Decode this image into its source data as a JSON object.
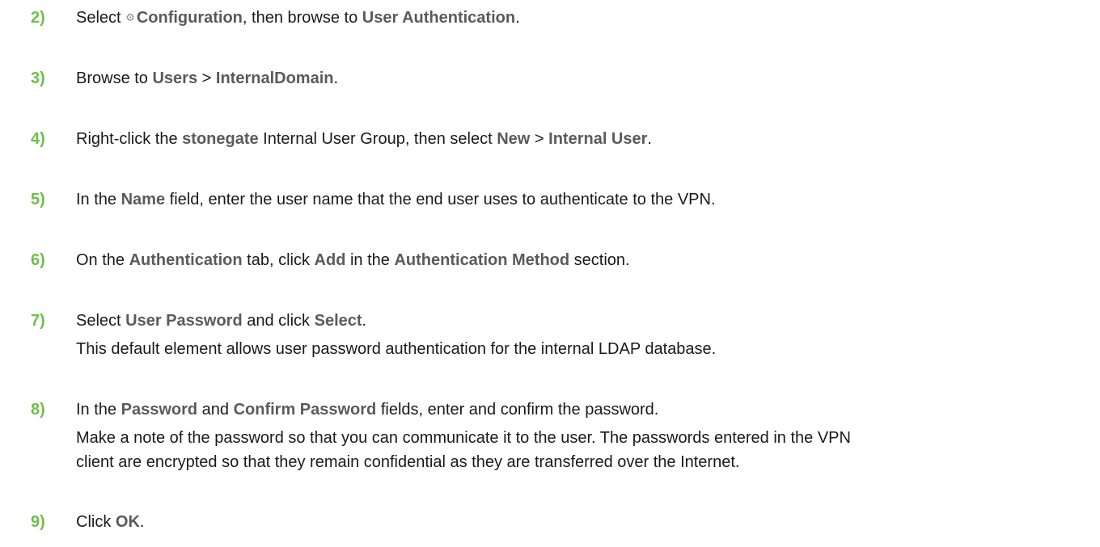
{
  "colors": {
    "step_number": "#6cc04a",
    "ui_term": "#5a5a5a",
    "body_text": "#1a1a1a"
  },
  "icons": {
    "configuration": "gear-icon"
  },
  "steps": [
    {
      "number": "2)",
      "t0": "Select ",
      "configuration_icon_glyph": "⚙",
      "t1": "Configuration",
      "t2": ", then browse to ",
      "t3": "User Authentication",
      "t4": "."
    },
    {
      "number": "3)",
      "t0": "Browse to ",
      "t1": "Users",
      "t2": " > ",
      "t3": "InternalDomain",
      "t4": "."
    },
    {
      "number": "4)",
      "t0": "Right-click the ",
      "t1": "stonegate",
      "t2": " Internal User Group, then select ",
      "t3": "New",
      "t4": " > ",
      "t5": "Internal User",
      "t6": "."
    },
    {
      "number": "5)",
      "t0": "In the ",
      "t1": "Name",
      "t2": " field, enter the user name that the end user uses to authenticate to the VPN."
    },
    {
      "number": "6)",
      "t0": "On the ",
      "t1": "Authentication",
      "t2": " tab, click ",
      "t3": "Add",
      "t4": " in the ",
      "t5": "Authentication Method",
      "t6": " section."
    },
    {
      "number": "7)",
      "t0": "Select ",
      "t1": "User Password",
      "t2": " and click ",
      "t3": "Select",
      "t4": ".",
      "note": "This default element allows user password authentication for the internal LDAP database."
    },
    {
      "number": "8)",
      "t0": "In the ",
      "t1": "Password",
      "t2": " and ",
      "t3": "Confirm Password",
      "t4": " fields, enter and confirm the password.",
      "note_line1": "Make a note of the password so that you can communicate it to the user. The passwords entered in the VPN",
      "note_line2": "client are encrypted so that they remain confidential as they are transferred over the Internet."
    },
    {
      "number": "9)",
      "t0": "Click ",
      "t1": "OK",
      "t2": "."
    }
  ]
}
